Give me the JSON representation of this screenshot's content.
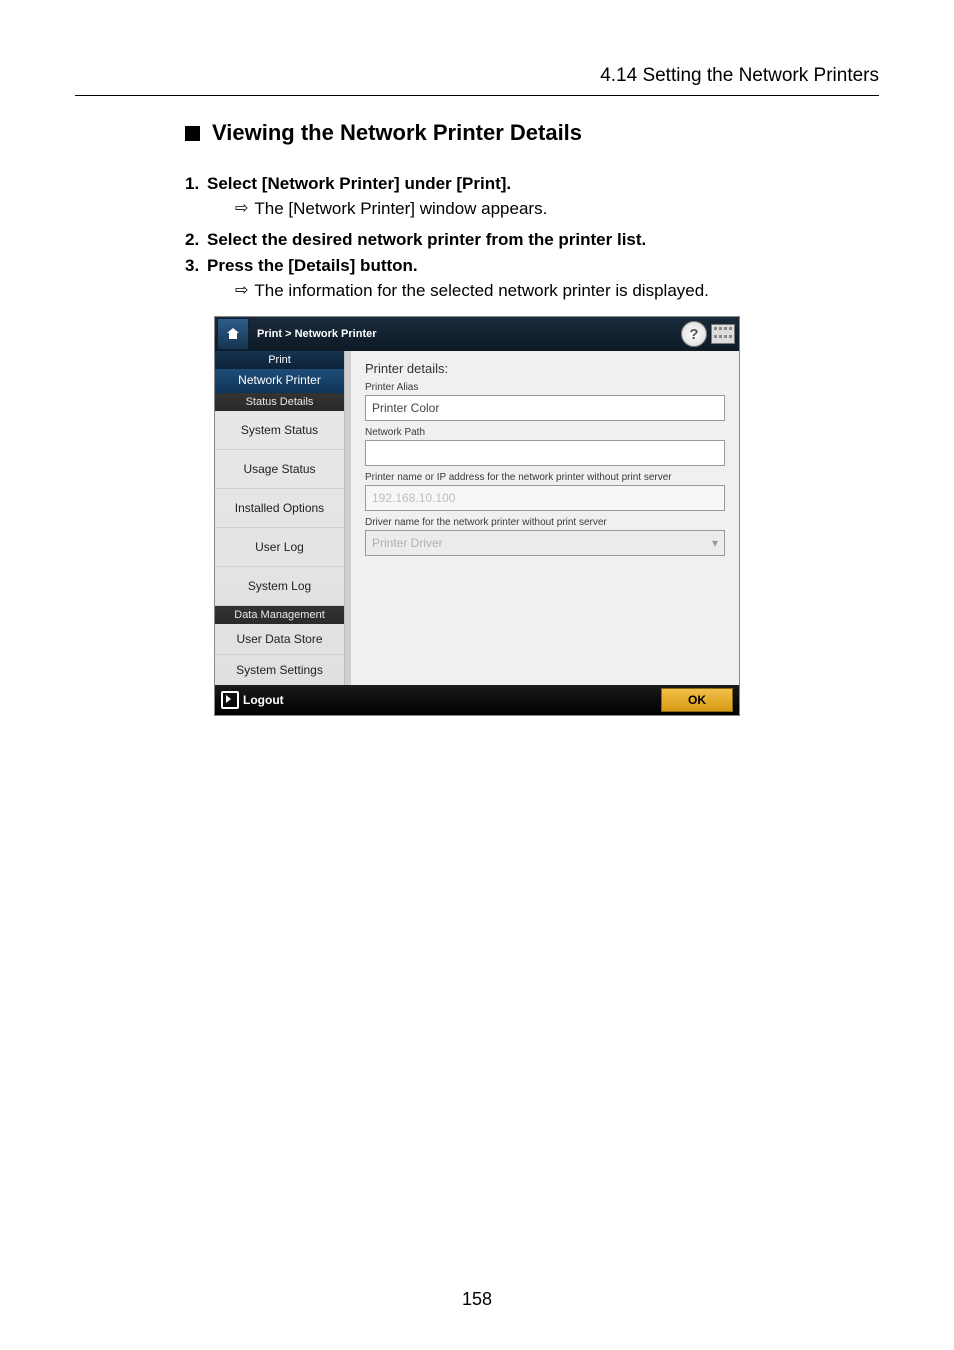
{
  "header": {
    "section_ref": "4.14 Setting the Network Printers"
  },
  "title": "Viewing the Network Printer Details",
  "steps": [
    {
      "num": "1.",
      "text": "Select [Network Printer] under [Print].",
      "result": "The [Network Printer] window appears."
    },
    {
      "num": "2.",
      "text": "Select the desired network printer from the printer list."
    },
    {
      "num": "3.",
      "text": "Press the [Details] button.",
      "result": "The information for the selected network printer is displayed."
    }
  ],
  "screenshot": {
    "breadcrumb": "Print  >  Network Printer",
    "sidebar": {
      "group_print": "Print",
      "selected": "Network Printer",
      "group_status": "Status Details",
      "items1": [
        "System Status",
        "Usage Status",
        "Installed Options",
        "User Log",
        "System Log"
      ],
      "group_data": "Data Management",
      "items2": [
        "User Data Store",
        "System Settings"
      ]
    },
    "content": {
      "title": "Printer details:",
      "alias_label": "Printer Alias",
      "alias_value": "Printer Color",
      "path_label": "Network Path",
      "ip_label": "Printer name or IP address for the network printer without print server",
      "ip_value": "192.168.10.100",
      "driver_label": "Driver name for the network printer without print server",
      "driver_value": "Printer Driver"
    },
    "footer": {
      "logout": "Logout",
      "ok": "OK"
    }
  },
  "page_number": "158"
}
